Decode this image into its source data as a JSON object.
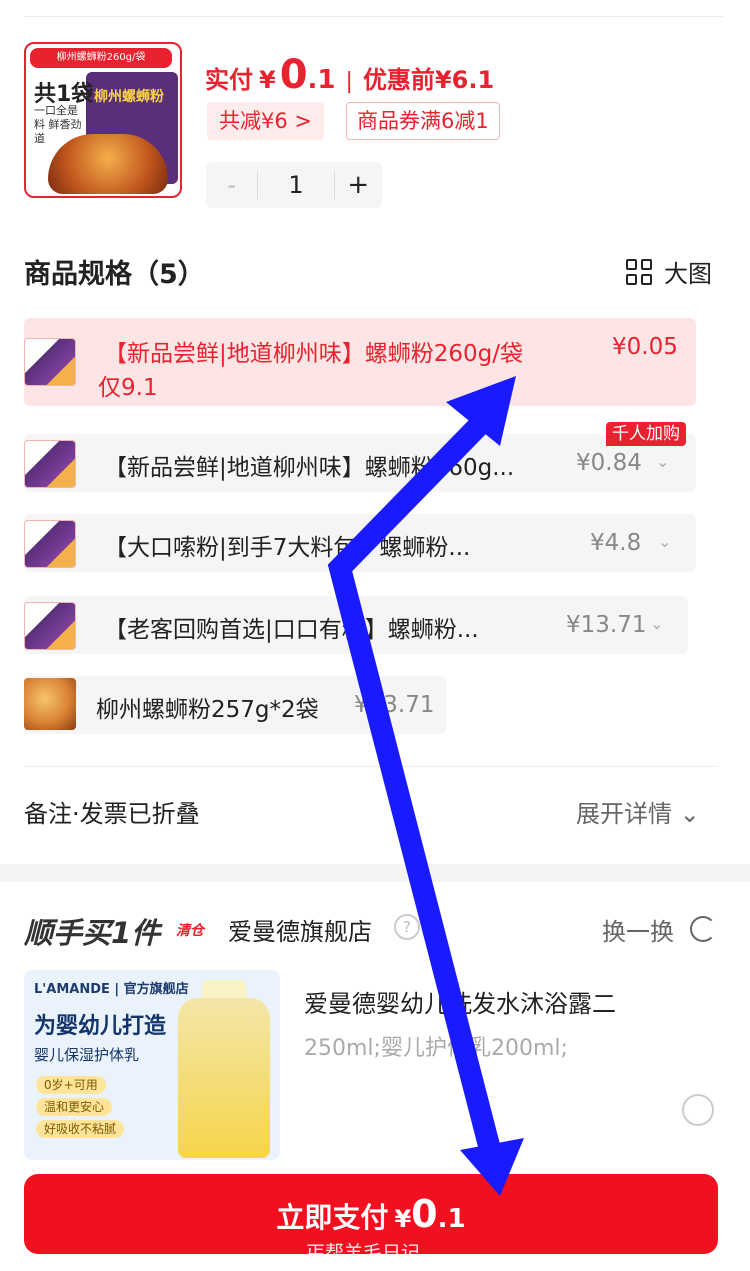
{
  "product": {
    "thumb_tag": "柳州螺蛳粉260g/袋",
    "thumb_count": "共1袋",
    "thumb_slogan": "一口全是料 鲜香劲道",
    "thumb_pack_title": "柳州螺蛳粉",
    "paid_label": "实付",
    "currency": "¥",
    "paid_int": "0",
    "paid_dec": ".1",
    "separator": "|",
    "original_price": "优惠前¥6.1",
    "discount_chip": "共减¥6 >",
    "coupon_chip": "商品券满6减1",
    "quantity": "1",
    "minus": "-",
    "plus": "+"
  },
  "spec": {
    "title": "商品规格（5）",
    "bigview_label": "大图",
    "options": [
      {
        "label": "【新品尝鲜|地道柳州味】螺蛳粉260g/袋",
        "label2": "仅9.1",
        "price": "¥0.05",
        "selected": true
      },
      {
        "label": "【新品尝鲜|地道柳州味】螺蛳粉260g...",
        "price": "¥0.84",
        "badge": "千人加购"
      },
      {
        "label": "【大口嗦粉|到手7大料包】螺蛳粉...",
        "price": "¥4.8"
      },
      {
        "label": "【老客回购首选|口口有料】螺蛳粉...",
        "price": "¥13.71"
      },
      {
        "label": "柳州螺蛳粉257g*2袋",
        "price": "¥13.71"
      }
    ]
  },
  "remark": {
    "label": "备注·发票已折叠",
    "expand": "展开详情"
  },
  "addon": {
    "title": "顺手买1件",
    "tag": "清仓",
    "store": "爱曼德旗舰店",
    "swap": "换一换",
    "promo_brand": "L'AMANDE | 官方旗舰店",
    "promo_headline": "为婴幼儿打造",
    "promo_sub": "婴儿保湿护体乳",
    "promo_pills": [
      "0岁+可用",
      "温和更安心",
      "好吸收不粘腻"
    ],
    "name": "爱曼德婴幼儿洗发水沐浴露二",
    "spec": "250ml;婴儿护体乳200ml;"
  },
  "pay": {
    "label": "立即支付",
    "currency": "¥",
    "int": "0",
    "dec": ".1"
  },
  "watermark": "丐帮羊毛日记",
  "colors": {
    "accent": "#e8232f",
    "button": "#f0101f",
    "annotation_arrow": "#1a1aff"
  }
}
